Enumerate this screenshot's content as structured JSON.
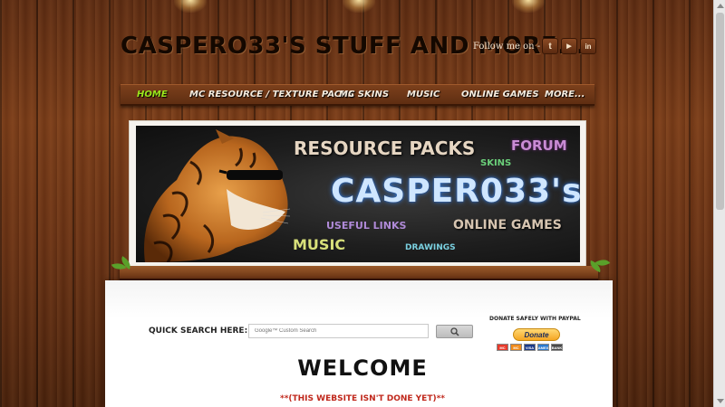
{
  "header": {
    "title": "CASPERO33'S STUFF AND MORE...",
    "follow_text": "Follow me on - ->",
    "social": [
      {
        "name": "twitter",
        "glyph": "t"
      },
      {
        "name": "youtube",
        "glyph": "▶"
      },
      {
        "name": "linkedin",
        "glyph": "in"
      }
    ]
  },
  "nav": {
    "items": [
      {
        "label": "HOME",
        "active": true
      },
      {
        "label": "MC RESOURCE / TEXTURE PACKS",
        "active": false
      },
      {
        "label": "MC SKINS",
        "active": false
      },
      {
        "label": "MUSIC",
        "active": false
      },
      {
        "label": "ONLINE GAMES",
        "active": false
      },
      {
        "label": "MORE...",
        "active": false
      }
    ]
  },
  "banner": {
    "resource_packs": "RESOURCE PACKS",
    "forum": "FORUM",
    "skins": "SKINS",
    "name": "CASPER033's",
    "useful_links": "USEFUL LINKS",
    "online_games": "ONLINE GAMES",
    "music": "MUSIC",
    "drawings": "DRAWINGS"
  },
  "search": {
    "label": "QUICK SEARCH HERE:",
    "placeholder": "Google™ Custom Search"
  },
  "donate": {
    "label": "DONATE SAFELY WITH PAYPAL",
    "button": "Donate",
    "cards": [
      "MC",
      "MC",
      "VISA",
      "AMEX",
      "BANK"
    ]
  },
  "main": {
    "heading": "WELCOME",
    "note": "**(THIS WEBSITE ISN'T DONE YET)**"
  },
  "colors": {
    "nav_active": "#9be61c",
    "note_red": "#c0281c"
  }
}
